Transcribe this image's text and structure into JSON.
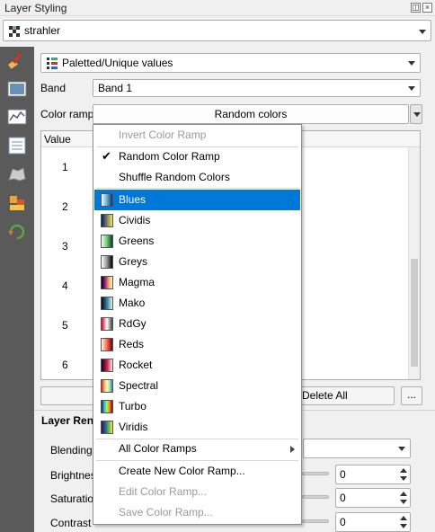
{
  "panel": {
    "title": "Layer Styling"
  },
  "layer": {
    "name": "strahler"
  },
  "renderer": {
    "type": "Paletted/Unique values"
  },
  "band": {
    "label": "Band",
    "value": "Band 1"
  },
  "color_ramp": {
    "label": "Color ramp",
    "value": "Random colors"
  },
  "table": {
    "header": "Value",
    "values": [
      "1",
      "2",
      "3",
      "4",
      "5",
      "6"
    ]
  },
  "buttons": {
    "delete_all": "Delete All",
    "more": "..."
  },
  "layer_rendering": {
    "title": "Layer Ren",
    "blending_label": "Blending n",
    "brightness_label": "Brightness",
    "brightness_value": "0",
    "saturation_label": "Saturation",
    "saturation_value": "0",
    "contrast_label": "Contrast",
    "contrast_value": "0"
  },
  "menu": {
    "invert": "Invert Color Ramp",
    "random_ramp": "Random Color Ramp",
    "shuffle": "Shuffle Random Colors",
    "ramps": [
      "Blues",
      "Cividis",
      "Greens",
      "Greys",
      "Magma",
      "Mako",
      "RdGy",
      "Reds",
      "Rocket",
      "Spectral",
      "Turbo",
      "Viridis"
    ],
    "all_ramps": "All Color Ramps",
    "create_new": "Create New Color Ramp...",
    "edit": "Edit Color Ramp...",
    "save": "Save Color Ramp..."
  },
  "colors": {
    "selection": "#0078d7",
    "sidebar": "#5a5a5a"
  }
}
